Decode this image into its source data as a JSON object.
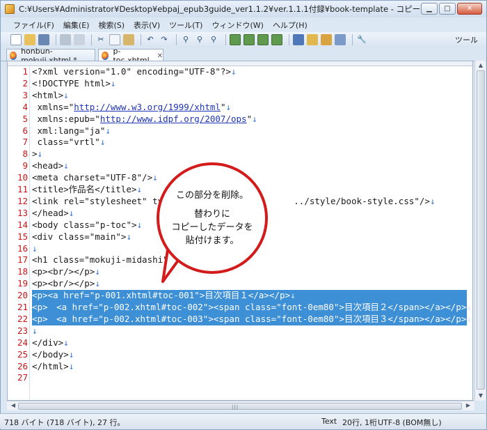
{
  "window": {
    "title": "C:¥Users¥Administrator¥Desktop¥ebpaj_epub3guide_ver1.1.2¥ver.1.1.1付録¥book-template - コピー¥item¥xhtml¥p-toc.xht...",
    "minimize": "▁",
    "maximize": "□",
    "close": "✕"
  },
  "menu": [
    "ファイル(F)",
    "編集(E)",
    "検索(S)",
    "表示(V)",
    "ツール(T)",
    "ウィンドウ(W)",
    "ヘルプ(H)"
  ],
  "toolbar": {
    "tools_label": "ツール"
  },
  "tabs": [
    {
      "label": "honbun-mokuji.xhtml *",
      "active": false
    },
    {
      "label": "p-toc.xhtml",
      "active": true,
      "close": "✕"
    }
  ],
  "line_numbers": [
    "1",
    "2",
    "3",
    "4",
    "5",
    "6",
    "7",
    "8",
    "9",
    "10",
    "11",
    "12",
    "13",
    "14",
    "15",
    "16",
    "17",
    "18",
    "19",
    "20",
    "21",
    "22",
    "23",
    "24",
    "25",
    "26",
    "27"
  ],
  "code_lines": [
    "<?xml version=\"1.0\" encoding=\"UTF-8\"?>",
    "<!DOCTYPE html>",
    "<html>",
    " xmlns=\"http://www.w3.org/1999/xhtml\"",
    " xmlns:epub=\"http://www.idpf.org/2007/ops\"",
    " xml:lang=\"ja\"",
    " class=\"vrtl\"",
    ">",
    "<head>",
    "<meta charset=\"UTF-8\"/>",
    "<title>作品名</title>",
    "<link rel=\"stylesheet\" typ                        ../style/book-style.css\"/>",
    "</head>",
    "<body class=\"p-toc\">",
    "<div class=\"main\">",
    "",
    "<h1 class=\"mokuji-midashi\">",
    "<p><br/></p>",
    "<p><br/></p>",
    "<p><a href=\"p-001.xhtml#toc-001\">目次項目１</a></p>",
    "<p>　<a href=\"p-002.xhtml#toc-002\"><span class=\"font-0em80\">目次項目２</span></a></p>",
    "<p>　<a href=\"p-002.xhtml#toc-003\"><span class=\"font-0em80\">目次項目３</span></a></p>",
    "",
    "</div>",
    "</body>",
    "</html>",
    ""
  ],
  "newline_mark": "↓",
  "callout": {
    "line1": "この部分を削除。",
    "line2": "替わりに",
    "line3": "コピーしたデータを",
    "line4": "貼付けます。"
  },
  "status": {
    "size": "718 バイト (718 バイト), 27 行。",
    "mode": "Text",
    "position": "20行, 1桁",
    "encoding": "UTF-8 (BOM無し)"
  },
  "colors": {
    "selection": "#3d8fd6",
    "line_number": "#cc1515",
    "callout_border": "#d41b1b",
    "newline_mark": "#3a78d3"
  }
}
